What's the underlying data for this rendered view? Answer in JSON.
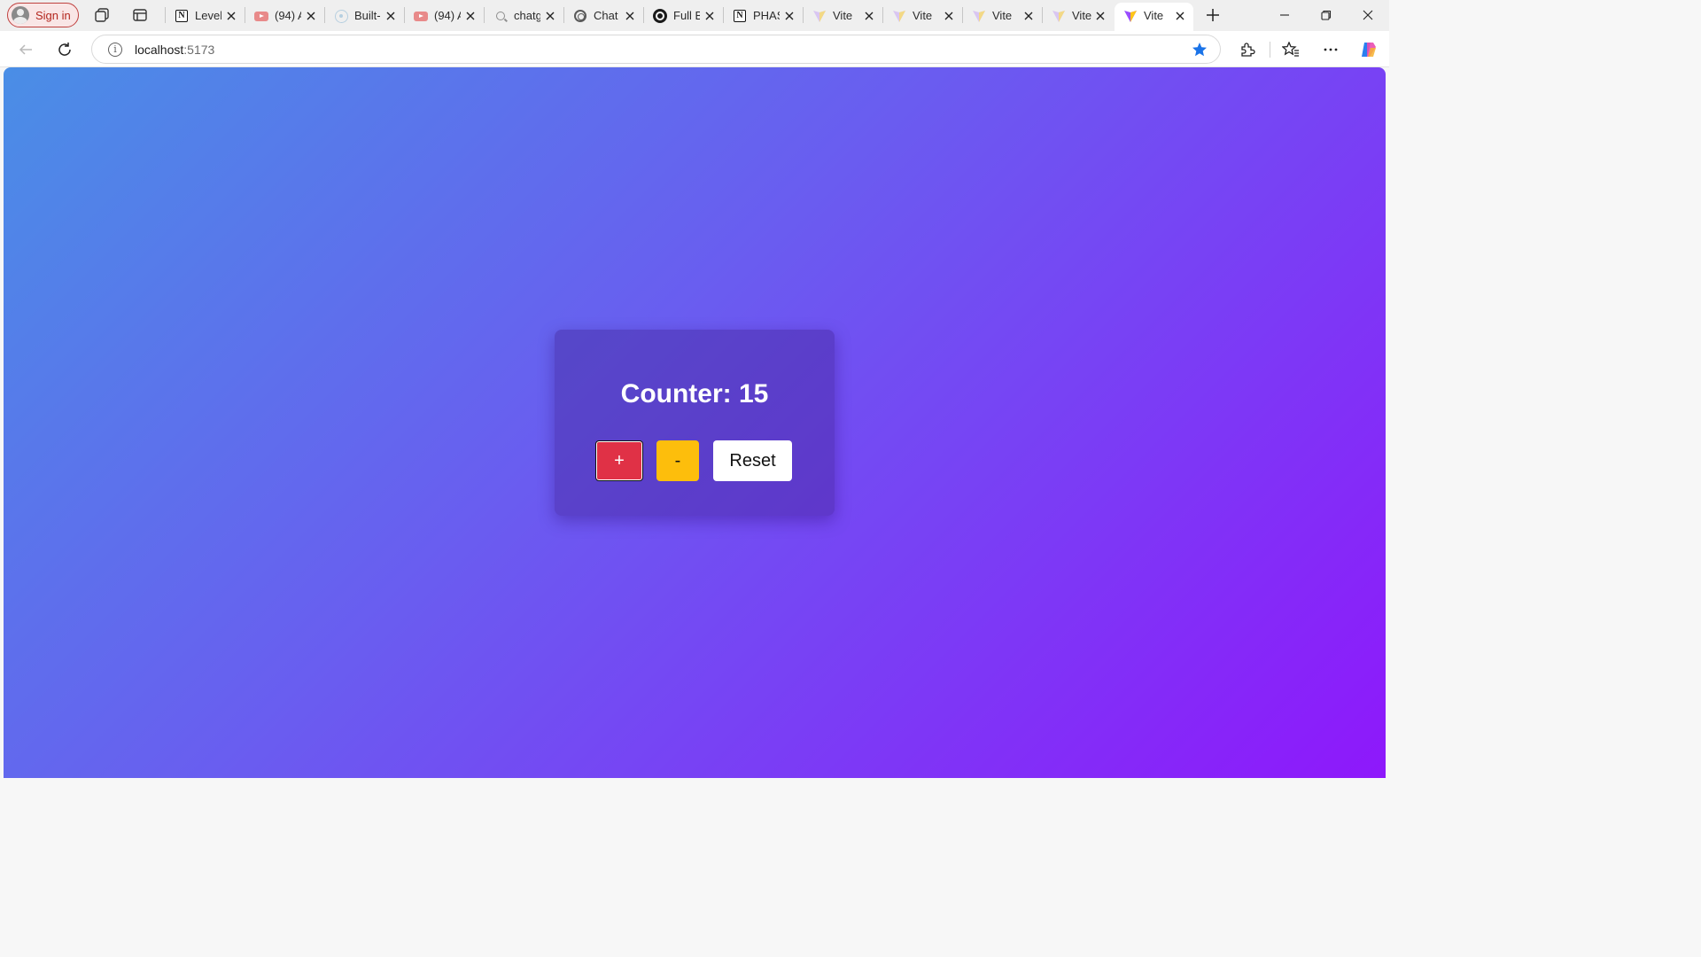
{
  "browser": {
    "profile_label": "Sign in",
    "tabs": [
      {
        "title": "Level",
        "favicon": "notion-icon"
      },
      {
        "title": "(94) A",
        "favicon": "youtube-icon"
      },
      {
        "title": "Built-",
        "favicon": "react-icon"
      },
      {
        "title": "(94) A",
        "favicon": "youtube-icon"
      },
      {
        "title": "chatg",
        "favicon": "search-icon"
      },
      {
        "title": "Chat",
        "favicon": "openai-icon"
      },
      {
        "title": "Full B",
        "favicon": "openai-dark-icon"
      },
      {
        "title": "PHAS",
        "favicon": "notion-icon"
      },
      {
        "title": "Vite",
        "favicon": "vite-icon"
      },
      {
        "title": "Vite",
        "favicon": "vite-icon"
      },
      {
        "title": "Vite",
        "favicon": "vite-icon"
      },
      {
        "title": "Vite",
        "favicon": "vite-icon"
      },
      {
        "title": "Vite",
        "favicon": "vite-icon",
        "active": true
      }
    ],
    "address": {
      "host": "localhost",
      "port": ":5173"
    },
    "colors": {
      "accent_blue": "#1a73e8",
      "profile_red": "#c0413f"
    }
  },
  "app": {
    "counter_label": "Counter: 15",
    "buttons": {
      "increment": "+",
      "decrement": "-",
      "reset": "Reset"
    },
    "colors": {
      "gradient_start": "#4a8ee6",
      "gradient_mid": "#6a5cf0",
      "gradient_end": "#8e18fb",
      "increment_bg": "#e03146",
      "decrement_bg": "#fdbe0c",
      "reset_bg": "#ffffff"
    }
  }
}
